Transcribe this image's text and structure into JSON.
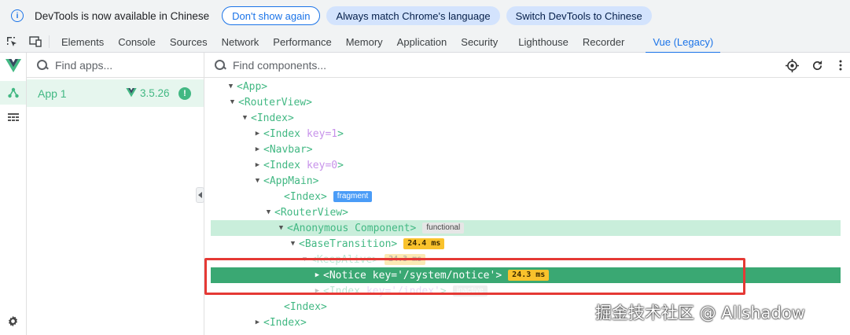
{
  "infobar": {
    "message": "DevTools is now available in Chinese",
    "dont_show": "Don't show again",
    "match_language": "Always match Chrome's language",
    "switch_chinese": "Switch DevTools to Chinese"
  },
  "tabs": [
    "Elements",
    "Console",
    "Sources",
    "Network",
    "Performance",
    "Memory",
    "Application",
    "Security",
    "Lighthouse",
    "Recorder",
    "Vue (Legacy)"
  ],
  "active_tab": "Vue (Legacy)",
  "apps": {
    "search_placeholder": "Find apps...",
    "items": [
      {
        "name": "App 1",
        "version": "3.5.26"
      }
    ]
  },
  "components": {
    "search_placeholder": "Find components...",
    "tree": [
      {
        "tag": "<App>",
        "expanded": true
      },
      {
        "tag": "<RouterView>",
        "expanded": true
      },
      {
        "tag": "<Index>",
        "expanded": true
      },
      {
        "tag": "<Index",
        "key": "key=1",
        "close": ">",
        "expanded": false
      },
      {
        "tag": "<Navbar>",
        "expanded": false
      },
      {
        "tag": "<Index",
        "key": "key=0",
        "close": ">",
        "expanded": false
      },
      {
        "tag": "<AppMain>",
        "expanded": true
      },
      {
        "tag": "<Index>",
        "badge": "fragment"
      },
      {
        "tag": "<RouterView>",
        "expanded": true
      },
      {
        "tag": "<Anonymous Component>",
        "badge": "functional",
        "expanded": true
      },
      {
        "tag": "<BaseTransition>",
        "timing": "24.4 ms",
        "expanded": true
      },
      {
        "tag": "<KeepAlive>",
        "timing": "24.3 ms",
        "expanded": true
      },
      {
        "tag": "<Notice",
        "key": "key='/system/notice'",
        "close": ">",
        "timing": "24.3 ms",
        "expanded": false
      },
      {
        "tag": "<Index",
        "key": "key='/index'",
        "close": ">",
        "badge": "inactive",
        "expanded": false
      },
      {
        "tag": "<Index>"
      },
      {
        "tag": "<Index>",
        "expanded": false
      }
    ]
  },
  "watermark": "掘金技术社区 @ Allshadow",
  "colors": {
    "vue_green": "#42b883",
    "selected_row": "#3aa873",
    "highlight_box": "#e53935",
    "accent": "#1a73e8"
  }
}
